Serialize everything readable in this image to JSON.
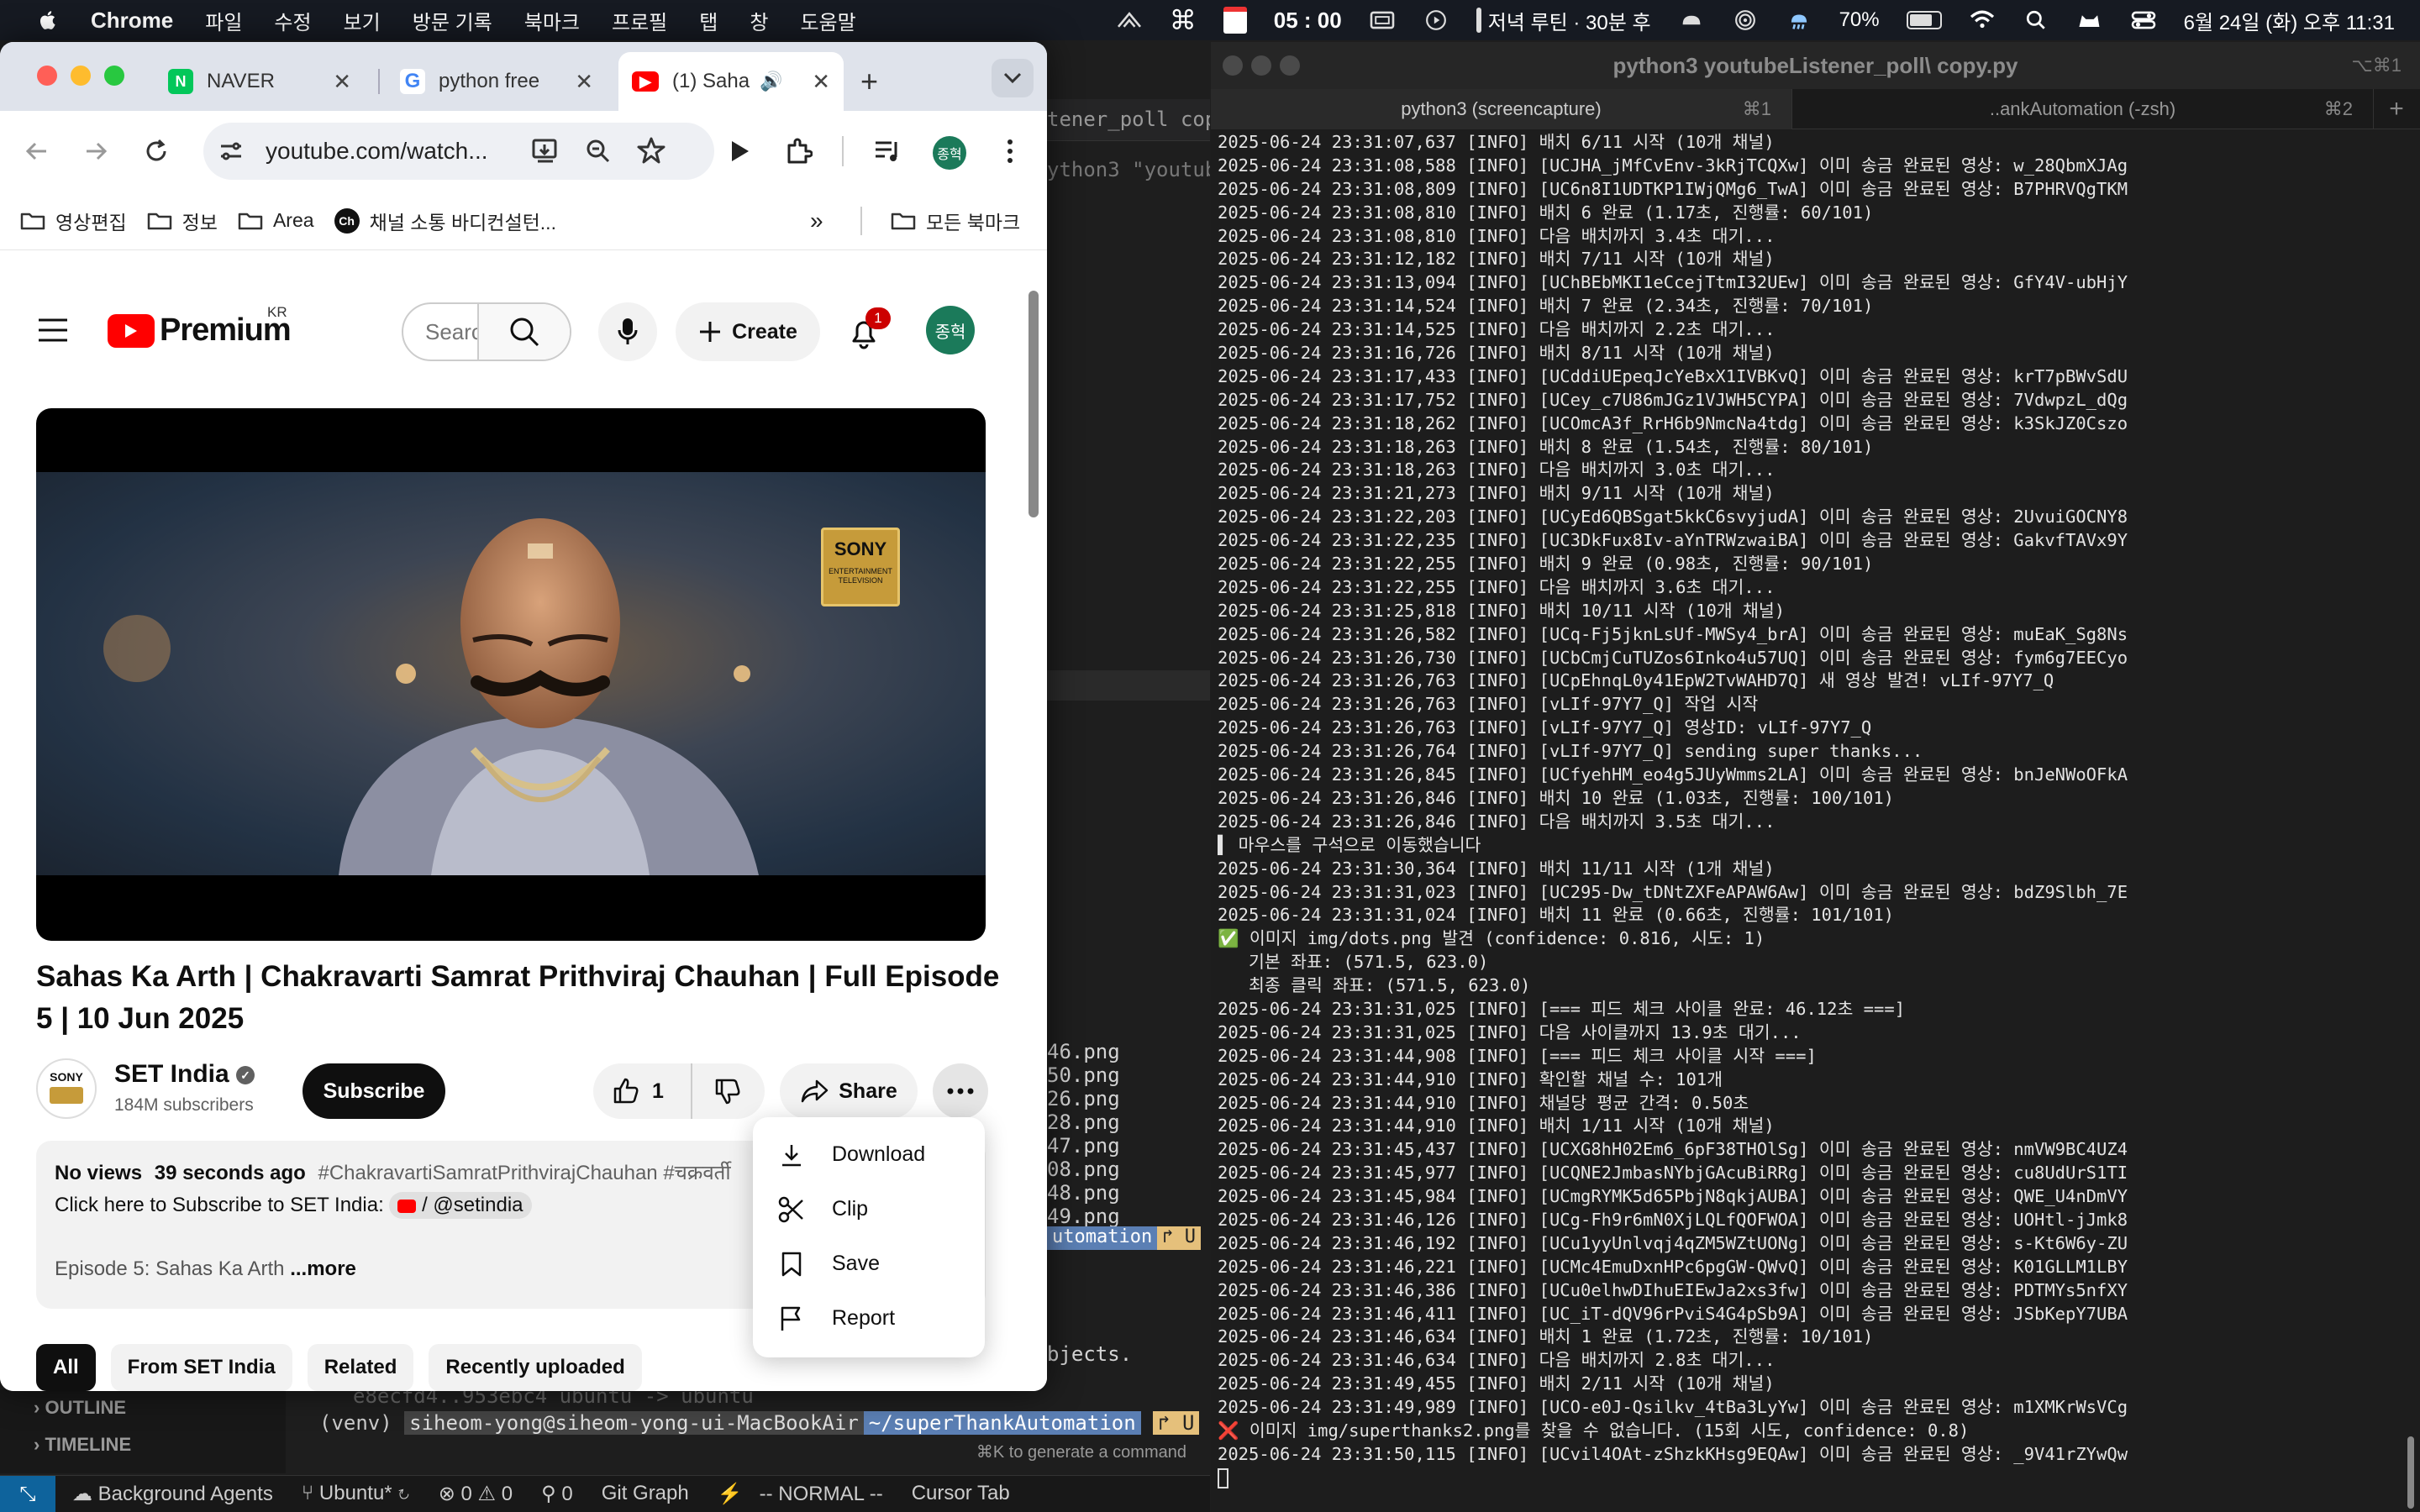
{
  "menubar": {
    "app_name": "Chrome",
    "menus": [
      "파일",
      "수정",
      "보기",
      "방문 기록",
      "북마크",
      "프로필",
      "탭",
      "창",
      "도움말"
    ],
    "timer": "05 : 00",
    "reminder": "저녁 루틴 · 30분 후",
    "battery": "70%",
    "datetime": "6월 24일 (화) 오후 11:31"
  },
  "chrome": {
    "tabs": [
      {
        "title": "NAVER",
        "favicon": "naver-icon",
        "color": "#03c75a"
      },
      {
        "title": "python free",
        "favicon": "google-icon",
        "color": "#4285f4"
      },
      {
        "title": "(1) Saha",
        "favicon": "youtube-icon",
        "color": "#ff0000"
      }
    ],
    "url": "youtube.com/watch...",
    "profile_initials": "종혁",
    "bookmarks": [
      {
        "label": "영상편집",
        "icon": "folder-icon"
      },
      {
        "label": "정보",
        "icon": "folder-icon"
      },
      {
        "label": "Area",
        "icon": "folder-icon"
      },
      {
        "label": "채널 소통 바디컨설턴...",
        "icon": "ch-icon"
      }
    ],
    "all_bookmarks": "모든 북마크"
  },
  "youtube": {
    "logo_text": "Premium",
    "region": "KR",
    "search_placeholder": "Search",
    "create_label": "Create",
    "notif_count": "1",
    "avatar_initials": "종혁",
    "video_title": "Sahas Ka Arth | Chakravarti Samrat Prithviraj Chauhan | Full Episode 5 | 10 Jun 2025",
    "channel": {
      "name": "SET India",
      "subscribers": "184M subscribers",
      "subscribe_label": "Subscribe"
    },
    "like_count": "1",
    "share_label": "Share",
    "description": {
      "views": "No views",
      "time": "39 seconds ago",
      "hashtags": "#ChakravartiSamratPrithvirajChauhan #चक्रवर्ती",
      "subscribe_line": "Click here to Subscribe to SET India:",
      "handle": "/ @setindia",
      "episode_line": "Episode 5: Sahas Ka Arth",
      "more": "...more"
    },
    "filters": [
      "All",
      "From SET India",
      "Related",
      "Recently uploaded"
    ],
    "menu": [
      {
        "label": "Download",
        "icon": "download-icon"
      },
      {
        "label": "Clip",
        "icon": "scissors-icon"
      },
      {
        "label": "Save",
        "icon": "bookmark-icon"
      },
      {
        "label": "Report",
        "icon": "flag-icon"
      }
    ],
    "sony": {
      "brand": "SONY",
      "sub": "ENTERTAINMENT TELEVISION"
    }
  },
  "vscode": {
    "tab_fragment": "tener_poll copy.p",
    "cmd_fragment": "ython3 \"youtube",
    "png_lines": [
      "46.png",
      "50.png",
      "26.png",
      "28.png",
      "47.png",
      "08.png",
      "48.png",
      "49.png"
    ],
    "powerline_fragment": "utomation",
    "objects_fragment": "bjects.",
    "outline": "OUTLINE",
    "timeline": "TIMELINE",
    "faded_line": "e8ecfd4..953ebc4  ubuntu -> ubuntu",
    "prompt_venv": "(venv)",
    "prompt_host": "siheom-yong@siheom-yong-ui-MacBookAir",
    "prompt_path": "~/superThankAutomation",
    "hint": "⌘K to generate a command",
    "status_items": [
      "Background Agents",
      "Ubuntu*",
      "0",
      "0",
      "0",
      "Git Graph",
      "-- NORMAL --",
      "Cursor Tab"
    ]
  },
  "iterm": {
    "title": "python3 youtubeListener_poll\\ copy.py",
    "title_shortcut": "⌥⌘1",
    "tabs": [
      {
        "label": "python3 (screencapture)",
        "shortcut": "⌘1"
      },
      {
        "label": "..ankAutomation (-zsh)",
        "shortcut": "⌘2"
      }
    ],
    "lines": [
      "2025-06-24 23:31:07,637 [INFO] 배치 6/11 시작 (10개 채널)",
      "2025-06-24 23:31:08,588 [INFO] [UCJHA_jMfCvEnv-3kRjTCQXw] 이미 송금 완료된 영상: w_28QbmXJAg",
      "2025-06-24 23:31:08,809 [INFO] [UC6n8I1UDTKP1IWjQMg6_TwA] 이미 송금 완료된 영상: B7PHRVQgTKM",
      "2025-06-24 23:31:08,810 [INFO] 배치 6 완료 (1.17초, 진행률: 60/101)",
      "2025-06-24 23:31:08,810 [INFO] 다음 배치까지 3.4초 대기...",
      "2025-06-24 23:31:12,182 [INFO] 배치 7/11 시작 (10개 채널)",
      "2025-06-24 23:31:13,094 [INFO] [UChBEbMKI1eCcejTtmI32UEw] 이미 송금 완료된 영상: GfY4V-ubHjY",
      "2025-06-24 23:31:14,524 [INFO] 배치 7 완료 (2.34초, 진행률: 70/101)",
      "2025-06-24 23:31:14,525 [INFO] 다음 배치까지 2.2초 대기...",
      "2025-06-24 23:31:16,726 [INFO] 배치 8/11 시작 (10개 채널)",
      "2025-06-24 23:31:17,433 [INFO] [UCddiUEpeqJcYeBxX1IVBKvQ] 이미 송금 완료된 영상: krT7pBWvSdU",
      "2025-06-24 23:31:17,752 [INFO] [UCey_c7U86mJGz1VJWH5CYPA] 이미 송금 완료된 영상: 7VdwpzL_dQg",
      "2025-06-24 23:31:18,262 [INFO] [UCOmcA3f_RrH6b9NmcNa4tdg] 이미 송금 완료된 영상: k3SkJZ0Cszo",
      "2025-06-24 23:31:18,263 [INFO] 배치 8 완료 (1.54초, 진행률: 80/101)",
      "2025-06-24 23:31:18,263 [INFO] 다음 배치까지 3.0초 대기...",
      "2025-06-24 23:31:21,273 [INFO] 배치 9/11 시작 (10개 채널)",
      "2025-06-24 23:31:22,203 [INFO] [UCyEd6QBSgat5kkC6svyjudA] 이미 송금 완료된 영상: 2UvuiGOCNY8",
      "2025-06-24 23:31:22,235 [INFO] [UC3DkFux8Iv-aYnTRWzwaiBA] 이미 송금 완료된 영상: GakvfTAVx9Y",
      "2025-06-24 23:31:22,255 [INFO] 배치 9 완료 (0.98초, 진행률: 90/101)",
      "2025-06-24 23:31:22,255 [INFO] 다음 배치까지 3.6초 대기...",
      "2025-06-24 23:31:25,818 [INFO] 배치 10/11 시작 (10개 채널)",
      "2025-06-24 23:31:26,582 [INFO] [UCq-Fj5jknLsUf-MWSy4_brA] 이미 송금 완료된 영상: muEaK_Sg8Ns",
      "2025-06-24 23:31:26,730 [INFO] [UCbCmjCuTUZos6Inko4u57UQ] 이미 송금 완료된 영상: fym6g7EECyo",
      "2025-06-24 23:31:26,763 [INFO] [UCpEhnqL0y41EpW2TvWAHD7Q] 새 영상 발견! vLIf-97Y7_Q",
      "2025-06-24 23:31:26,763 [INFO] [vLIf-97Y7_Q] 작업 시작",
      "2025-06-24 23:31:26,763 [INFO] [vLIf-97Y7_Q] 영상ID: vLIf-97Y7_Q",
      "2025-06-24 23:31:26,764 [INFO] [vLIf-97Y7_Q] sending super thanks...",
      "2025-06-24 23:31:26,845 [INFO] [UCfyehHM_eo4g5JUyWmms2LA] 이미 송금 완료된 영상: bnJeNWoOFkA",
      "2025-06-24 23:31:26,846 [INFO] 배치 10 완료 (1.03초, 진행률: 100/101)",
      "2025-06-24 23:31:26,846 [INFO] 다음 배치까지 3.5초 대기...",
      "▌ 마우스를 구석으로 이동했습니다",
      "2025-06-24 23:31:30,364 [INFO] 배치 11/11 시작 (1개 채널)",
      "2025-06-24 23:31:31,023 [INFO] [UC295-Dw_tDNtZXFeAPAW6Aw] 이미 송금 완료된 영상: bdZ9Slbh_7E",
      "2025-06-24 23:31:31,024 [INFO] 배치 11 완료 (0.66초, 진행률: 101/101)",
      "✅ 이미지 img/dots.png 발견 (confidence: 0.816, 시도: 1)",
      "   기본 좌표: (571.5, 623.0)",
      "   최종 클릭 좌표: (571.5, 623.0)",
      "2025-06-24 23:31:31,025 [INFO] [=== 피드 체크 사이클 완료: 46.12초 ===]",
      "2025-06-24 23:31:31,025 [INFO] 다음 사이클까지 13.9초 대기...",
      "2025-06-24 23:31:44,908 [INFO] [=== 피드 체크 사이클 시작 ===]",
      "2025-06-24 23:31:44,910 [INFO] 확인할 채널 수: 101개",
      "2025-06-24 23:31:44,910 [INFO] 채널당 평균 간격: 0.50초",
      "2025-06-24 23:31:44,910 [INFO] 배치 1/11 시작 (10개 채널)",
      "2025-06-24 23:31:45,437 [INFO] [UCXG8hH02Em6_6pF38THOlSg] 이미 송금 완료된 영상: nmVW9BC4UZ4",
      "2025-06-24 23:31:45,977 [INFO] [UCQNE2JmbasNYbjGAcuBiRRg] 이미 송금 완료된 영상: cu8UdUrS1TI",
      "2025-06-24 23:31:45,984 [INFO] [UCmgRYMK5d65PbjN8qkjAUBA] 이미 송금 완료된 영상: QWE_U4nDmVY",
      "2025-06-24 23:31:46,126 [INFO] [UCg-Fh9r6mN0XjLQLfQOFWOA] 이미 송금 완료된 영상: UOHtl-jJmk8",
      "2025-06-24 23:31:46,192 [INFO] [UCu1yyUnlvqj4qZM5WZtUONg] 이미 송금 완료된 영상: s-Kt6W6y-ZU",
      "2025-06-24 23:31:46,221 [INFO] [UCMc4EmuDxnHPc6pgGW-QWvQ] 이미 송금 완료된 영상: K01GLLM1LBY",
      "2025-06-24 23:31:46,386 [INFO] [UCu0elhwDIhuEIEwJa2xs3fw] 이미 송금 완료된 영상: PDTMYs5nfXY",
      "2025-06-24 23:31:46,411 [INFO] [UC_iT-dQV96rPviS4G4pSb9A] 이미 송금 완료된 영상: JSbKepY7UBA",
      "2025-06-24 23:31:46,634 [INFO] 배치 1 완료 (1.72초, 진행률: 10/101)",
      "2025-06-24 23:31:46,634 [INFO] 다음 배치까지 2.8초 대기...",
      "2025-06-24 23:31:49,455 [INFO] 배치 2/11 시작 (10개 채널)",
      "2025-06-24 23:31:49,989 [INFO] [UCO-e0J-Qsilkv_4tBa3LyYw] 이미 송금 완료된 영상: m1XMKrWsVCg",
      "❌ 이미지 img/superthanks2.png를 찾을 수 없습니다. (15회 시도, confidence: 0.8)",
      "2025-06-24 23:31:50,115 [INFO] [UCvil4OAt-zShzkKHsg9EQAw] 이미 송금 완료된 영상: _9V41rZYwQw"
    ]
  }
}
